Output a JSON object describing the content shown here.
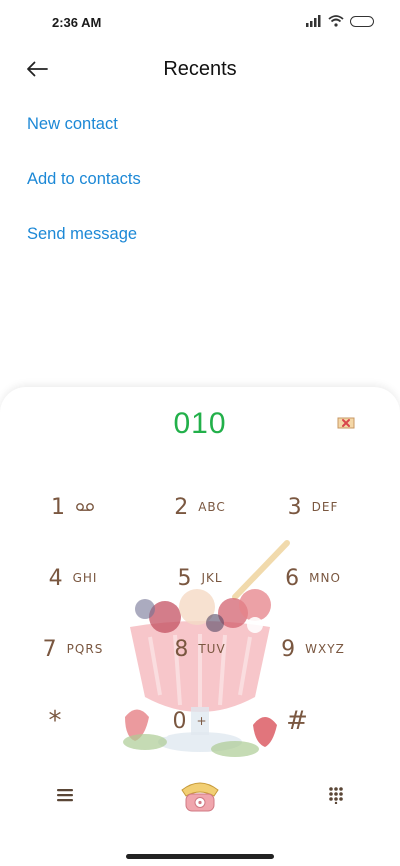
{
  "status_bar": {
    "time": "2:36 AM"
  },
  "header": {
    "title": "Recents"
  },
  "actions": {
    "new_contact": "New contact",
    "add_to_contacts": "Add to contacts",
    "send_message": "Send message"
  },
  "dialer": {
    "number": "010",
    "keys": [
      {
        "digit": "1",
        "letters": ""
      },
      {
        "digit": "2",
        "letters": "ABC"
      },
      {
        "digit": "3",
        "letters": "DEF"
      },
      {
        "digit": "4",
        "letters": "GHI"
      },
      {
        "digit": "5",
        "letters": "JKL"
      },
      {
        "digit": "6",
        "letters": "MNO"
      },
      {
        "digit": "7",
        "letters": "PQRS"
      },
      {
        "digit": "8",
        "letters": "TUV"
      },
      {
        "digit": "9",
        "letters": "WXYZ"
      },
      {
        "digit": "*",
        "letters": ""
      },
      {
        "digit": "0",
        "letters": "+"
      },
      {
        "digit": "#",
        "letters": ""
      }
    ]
  },
  "colors": {
    "link": "#1c88d6",
    "dialed_number": "#22b04a",
    "key_text": "#7a5740"
  },
  "icons": [
    "back-arrow-icon",
    "signal-icon",
    "wifi-icon",
    "battery-icon",
    "delete-icon",
    "voicemail-icon",
    "menu-icon",
    "call-icon",
    "keypad-icon"
  ]
}
